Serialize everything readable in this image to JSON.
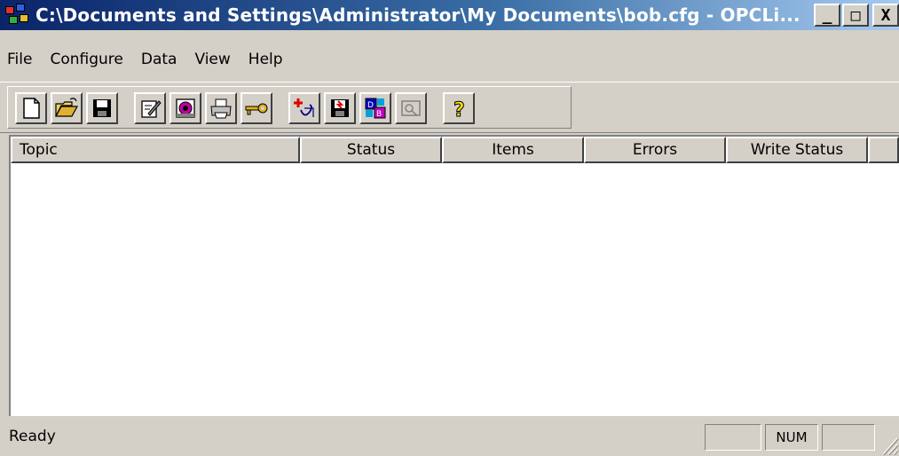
{
  "window": {
    "title": "C:\\Documents and Settings\\Administrator\\My Documents\\bob.cfg - OPCLi...",
    "minimize_glyph": "_",
    "maximize_glyph": "□",
    "close_glyph": "X"
  },
  "menu": [
    "File",
    "Configure",
    "Data",
    "View",
    "Help"
  ],
  "toolbar": {
    "buttons": [
      {
        "name": "new-icon"
      },
      {
        "name": "open-folder-icon"
      },
      {
        "name": "save-icon"
      },
      {
        "name": "edit-icon"
      },
      {
        "name": "device-icon"
      },
      {
        "name": "print-icon"
      },
      {
        "name": "key-icon"
      },
      {
        "name": "add-topic-icon"
      },
      {
        "name": "save-data-icon"
      },
      {
        "name": "database-icon"
      },
      {
        "name": "monitor-icon"
      },
      {
        "name": "help-icon"
      }
    ]
  },
  "list": {
    "columns": [
      "Topic",
      "Status",
      "Items",
      "Errors",
      "Write Status"
    ],
    "rows": []
  },
  "status": {
    "text": "Ready",
    "num": "NUM"
  },
  "colors": {
    "titlebar_start": "#0a246a",
    "titlebar_end": "#a6caf0",
    "face": "#d4d0c8"
  }
}
